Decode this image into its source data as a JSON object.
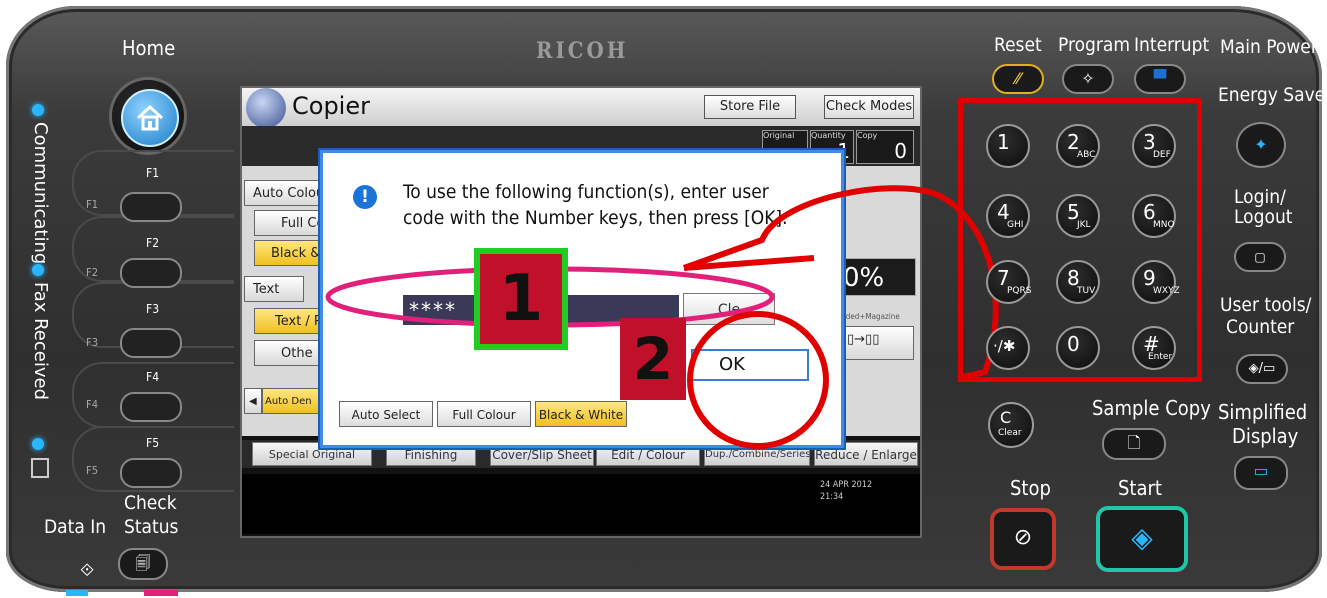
{
  "brand": "RICOH",
  "panel": {
    "home_label": "Home",
    "function_keys": [
      "F1",
      "F2",
      "F3",
      "F4",
      "F5"
    ],
    "side_function_labels": [
      "F1",
      "F2",
      "F3",
      "F4",
      "F5"
    ],
    "indicators": {
      "communicating": "Communicating",
      "fax_received": "Fax Received"
    },
    "data_in": "Data In",
    "check_status_line1": "Check",
    "check_status_line2": "Status"
  },
  "screen": {
    "app_title": "Copier",
    "store_file": "Store File",
    "check_modes": "Check Modes",
    "counters": {
      "original_label": "Original",
      "quantity_label": "Quantity",
      "copy_label": "Copy",
      "copy_value": "0",
      "quantity_value": "1"
    },
    "color_buttons": [
      "Auto Colour",
      "Full Co",
      "Black & W"
    ],
    "type_buttons": [
      "Text",
      "Text / P",
      "Othe"
    ],
    "auto_density": "Auto Den",
    "ratio": "0%",
    "magazine_label": "zided+Magazine",
    "tabs": [
      "Special Original",
      "Finishing",
      "Cover/Slip Sheet",
      "Edit / Colour",
      "Dup./Combine/Series",
      "Reduce / Enlarge"
    ],
    "date": "24 APR  2012",
    "time": "21:34"
  },
  "dialog": {
    "message_line1": "To use the following function(s), enter user",
    "message_line2": "code with the Number keys, then press [OK].",
    "code_value": "****",
    "clear_label": "Cle",
    "ok_label": "OK",
    "buttons": [
      "Auto Select",
      "Full Colour",
      "Black & White"
    ]
  },
  "annotations": {
    "step1": "1",
    "step2": "2"
  },
  "right_panel": {
    "reset": "Reset",
    "program": "Program",
    "interrupt": "Interrupt",
    "main_power": "Main Power",
    "energy_saver": "Energy Saver",
    "login_line1": "Login/",
    "login_line2": "Logout",
    "user_tools_line1": "User tools/",
    "user_tools_line2": "Counter",
    "sample_copy": "Sample Copy",
    "simplified_line1": "Simplified",
    "simplified_line2": "Display",
    "stop": "Stop",
    "start": "Start",
    "clear_sub": "Clear"
  },
  "keypad": [
    {
      "digit": "1",
      "sub": ""
    },
    {
      "digit": "2",
      "sub": "ABC"
    },
    {
      "digit": "3",
      "sub": "DEF"
    },
    {
      "digit": "4",
      "sub": "GHI"
    },
    {
      "digit": "5",
      "sub": "JKL"
    },
    {
      "digit": "6",
      "sub": "MNO"
    },
    {
      "digit": "7",
      "sub": "PQRS"
    },
    {
      "digit": "8",
      "sub": "TUV"
    },
    {
      "digit": "9",
      "sub": "WXYZ"
    },
    {
      "digit": "·/✱",
      "sub": ""
    },
    {
      "digit": "0",
      "sub": ""
    },
    {
      "digit": "#",
      "sub": "Enter"
    }
  ],
  "colors": {
    "highlight_red": "#e10000",
    "pink": "#e0207a",
    "green": "#22cc22",
    "step_box": "#c0102a",
    "accent_blue": "#29b6ff"
  }
}
